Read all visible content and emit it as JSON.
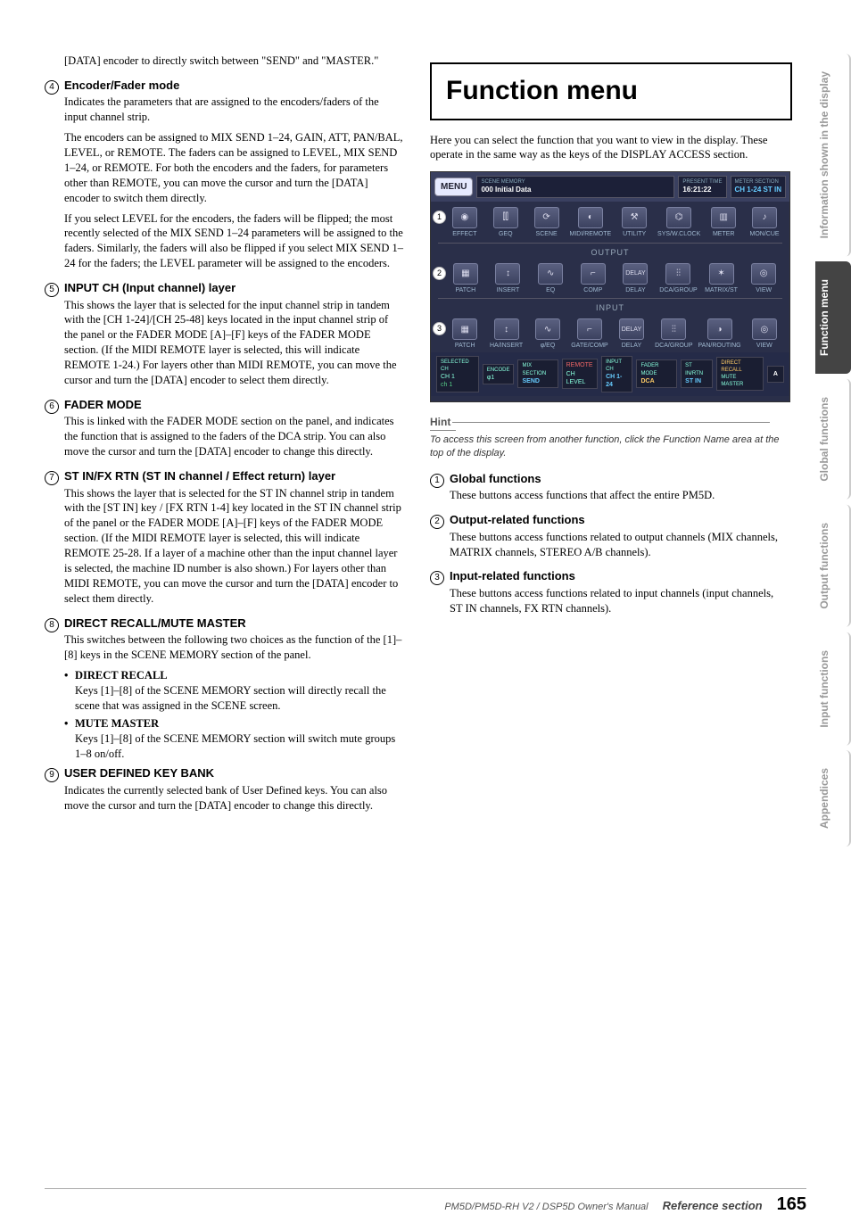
{
  "left": {
    "continuation_text": "[DATA] encoder to directly switch between \"SEND\" and \"MASTER.\"",
    "items": [
      {
        "num": "4",
        "title": "Encoder/Fader mode",
        "paras": [
          "Indicates the parameters that are assigned to the encoders/faders of the input channel strip.",
          "The encoders can be assigned to MIX SEND 1–24, GAIN, ATT, PAN/BAL, LEVEL, or REMOTE. The faders can be assigned to LEVEL, MIX SEND 1–24, or REMOTE. For both the encoders and the faders, for parameters other than REMOTE, you can move the cursor and turn the [DATA] encoder to switch them directly.",
          "If you select LEVEL for the encoders, the faders will be flipped; the most recently selected of the MIX SEND 1–24 parameters will be assigned to the faders. Similarly, the faders will also be flipped if you select MIX SEND 1–24 for the faders; the LEVEL parameter will be assigned to the encoders."
        ]
      },
      {
        "num": "5",
        "title": "INPUT CH (Input channel) layer",
        "paras": [
          "This shows the layer that is selected for the input channel strip in tandem with the [CH 1-24]/[CH 25-48] keys located in the input channel strip of the panel or the FADER MODE [A]–[F] keys of the FADER MODE section. (If the MIDI REMOTE layer is selected, this will indicate REMOTE 1-24.) For layers other than MIDI REMOTE, you can move the cursor and turn the [DATA] encoder to select them directly."
        ]
      },
      {
        "num": "6",
        "title": "FADER MODE",
        "paras": [
          "This is linked with the FADER MODE section on the panel, and indicates the function that is assigned to the faders of the DCA strip. You can also move the cursor and turn the [DATA] encoder to change this directly."
        ]
      },
      {
        "num": "7",
        "title": "ST IN/FX RTN (ST IN channel / Effect return) layer",
        "paras": [
          "This shows the layer that is selected for the ST IN channel strip in tandem with the [ST IN] key / [FX RTN 1-4] key located in the ST IN channel strip of the panel or the FADER MODE [A]–[F] keys of the FADER MODE section. (If the MIDI REMOTE layer is selected, this will indicate REMOTE 25-28. If a layer of a machine other than the input channel layer is selected, the machine ID number is also shown.) For layers other than MIDI REMOTE, you can move the cursor and turn the [DATA] encoder to select them directly."
        ]
      },
      {
        "num": "8",
        "title": "DIRECT RECALL/MUTE MASTER",
        "paras": [
          "This switches between the following two choices as the function of the [1]–[8] keys in the SCENE MEMORY section of the panel."
        ],
        "bullets": [
          {
            "title": "DIRECT RECALL",
            "text": "Keys [1]–[8] of the SCENE MEMORY section will directly recall the scene that was assigned in the SCENE screen."
          },
          {
            "title": "MUTE MASTER",
            "text": "Keys [1]–[8] of the SCENE MEMORY section will switch mute groups 1–8 on/off."
          }
        ]
      },
      {
        "num": "9",
        "title": "USER DEFINED KEY BANK",
        "paras": [
          "Indicates the currently selected bank of User Defined keys. You can also move the cursor and turn the [DATA] encoder to change this directly."
        ]
      }
    ]
  },
  "right": {
    "heading": "Function menu",
    "intro": "Here you can select the function that you want to view in the display. These operate in the same way as the keys of the DISPLAY ACCESS section.",
    "screenshot": {
      "menu_button": "MENU",
      "scene_memory_label": "SCENE MEMORY",
      "scene_memory": "000 Initial Data",
      "time_label": "PRESENT TIME",
      "time": "16:21:22",
      "meter_label": "METER SECTION",
      "meter_a": "CH 1-24",
      "meter_b": "ST IN",
      "row1": {
        "marker": "1",
        "cells": [
          "EFFECT",
          "GEQ",
          "SCENE",
          "MIDI/REMOTE",
          "UTILITY",
          "SYS/W.CLOCK",
          "METER",
          "MON/CUE"
        ]
      },
      "output_label": "OUTPUT",
      "row2": {
        "marker": "2",
        "cells": [
          "PATCH",
          "INSERT",
          "EQ",
          "COMP",
          "DELAY",
          "DCA/GROUP",
          "MATRIX/ST",
          "VIEW"
        ]
      },
      "input_label": "INPUT",
      "row3": {
        "marker": "3",
        "cells": [
          "PATCH",
          "HA/INSERT",
          "φ/EQ",
          "GATE/COMP",
          "DELAY",
          "DCA/GROUP",
          "PAN/ROUTING",
          "VIEW"
        ]
      },
      "bottom": {
        "selected_ch": "SELECTED CH",
        "ch_a": "CH 1",
        "ch_b": "ch 1",
        "encode": "ENCODE",
        "enc_val": "φ1",
        "mix_label": "MIX SECTION",
        "mix_val": "SEND",
        "remote": "REMOTE",
        "ch_level": "CH LEVEL",
        "input_ch": "INPUT CH",
        "input_val": "CH 1-24",
        "fader_mode": "FADER MODE",
        "fader_val": "DCA",
        "stin": "ST IN/RTN",
        "stin_val": "ST IN",
        "recall": "DIRECT RECALL",
        "mute": "MUTE MASTER",
        "bank": "A"
      }
    },
    "hint_label": "Hint",
    "hint_text": "To access this screen from another function, click the Function Name area at the top of the display.",
    "items": [
      {
        "num": "1",
        "title": "Global functions",
        "text": "These buttons access functions that affect the entire PM5D."
      },
      {
        "num": "2",
        "title": "Output-related functions",
        "text": "These buttons access functions related to output channels (MIX channels, MATRIX channels, STEREO A/B channels)."
      },
      {
        "num": "3",
        "title": "Input-related functions",
        "text": "These buttons access functions related to input channels (input channels, ST IN channels, FX RTN channels)."
      }
    ]
  },
  "tabs": [
    {
      "label": "Information shown\nin the display",
      "active": false
    },
    {
      "label": "Function\nmenu",
      "active": true
    },
    {
      "label": "Global\nfunctions",
      "active": false
    },
    {
      "label": "Output\nfunctions",
      "active": false
    },
    {
      "label": "Input\nfunctions",
      "active": false
    },
    {
      "label": "Appendices",
      "active": false
    }
  ],
  "footer": {
    "manual": "PM5D/PM5D-RH V2 / DSP5D Owner's Manual",
    "section": "Reference section",
    "page": "165"
  }
}
